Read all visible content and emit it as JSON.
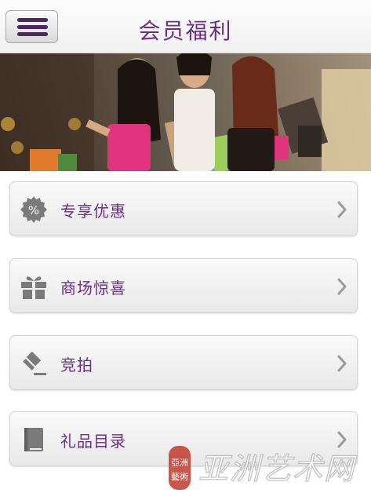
{
  "header": {
    "title": "会员福利"
  },
  "menu": [
    {
      "label": "专享优惠",
      "icon": "percent-badge-icon"
    },
    {
      "label": "商场惊喜",
      "icon": "gift-box-icon"
    },
    {
      "label": "竞拍",
      "icon": "auction-gavel-icon"
    },
    {
      "label": "礼品目录",
      "icon": "book-icon"
    }
  ],
  "watermark": {
    "stamp": "亞洲藝術",
    "text": "亚洲艺术网"
  },
  "colors": {
    "accent": "#6b2f86",
    "menu_bar": "#4a2a5e",
    "icon": "#7a7a7a"
  }
}
